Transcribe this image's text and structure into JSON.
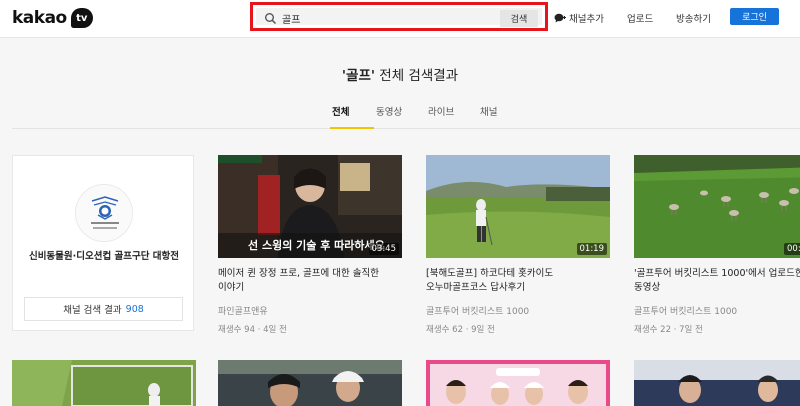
{
  "header": {
    "logo_text": "kakao",
    "logo_badge": "tv",
    "search": {
      "value": "골프",
      "button": "검색"
    },
    "links": {
      "add_channel": "채널추가",
      "upload": "업로드",
      "broadcast": "방송하기"
    },
    "login": "로그인",
    "accent_color": "#1673d9"
  },
  "results": {
    "query_quoted": "'골프'",
    "title_suffix": " 전체 검색결과"
  },
  "tabs": [
    {
      "label": "전체",
      "active": true
    },
    {
      "label": "동영상",
      "active": false
    },
    {
      "label": "라이브",
      "active": false
    },
    {
      "label": "채널",
      "active": false
    }
  ],
  "channel": {
    "name": "신비동물원·디오션컵 골프구단 대항전",
    "results_label": "채널 검색 결과",
    "results_count": "908"
  },
  "videos": [
    {
      "title_line1": "메이저 퀸 장정 프로, 골프에 대한 솔직한",
      "title_line2": "이야기",
      "channel": "파인골프앤유",
      "views": "재생수 94",
      "age": "4일 전",
      "duration": "03:45",
      "caption": "선 스윙의 기술 후 따라하세요"
    },
    {
      "title_line1": "[북해도골프] 하코다테 홋카이도",
      "title_line2": "오누마골프코스 답사후기",
      "channel": "골프투어 버킷리스트 1000",
      "views": "재생수 62",
      "age": "9일 전",
      "duration": "01:19"
    },
    {
      "title_line1": "'골프투어 버킷리스트 1000'에서 업로드한",
      "title_line2": "동영상",
      "channel": "골프투어 버킷리스트 1000",
      "views": "재생수 22",
      "age": "7일 전",
      "duration": "00:"
    }
  ],
  "meta_separator": "·"
}
